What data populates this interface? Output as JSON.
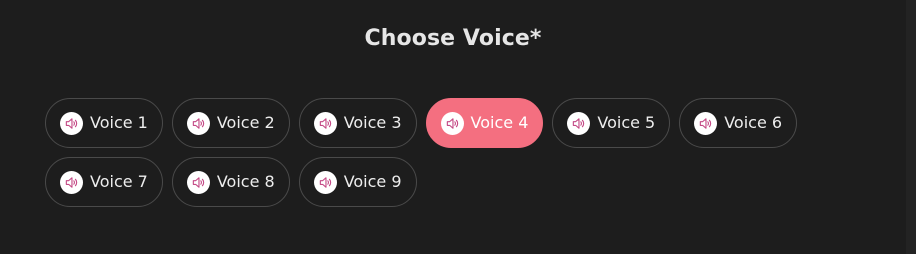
{
  "heading": "Choose Voice*",
  "accent_color": "#f46f80",
  "icon": "speaker-icon",
  "voices": [
    {
      "label": "Voice 1",
      "selected": false
    },
    {
      "label": "Voice 2",
      "selected": false
    },
    {
      "label": "Voice 3",
      "selected": false
    },
    {
      "label": "Voice 4",
      "selected": true
    },
    {
      "label": "Voice 5",
      "selected": false
    },
    {
      "label": "Voice 6",
      "selected": false
    },
    {
      "label": "Voice 7",
      "selected": false
    },
    {
      "label": "Voice 8",
      "selected": false
    },
    {
      "label": "Voice 9",
      "selected": false
    }
  ]
}
